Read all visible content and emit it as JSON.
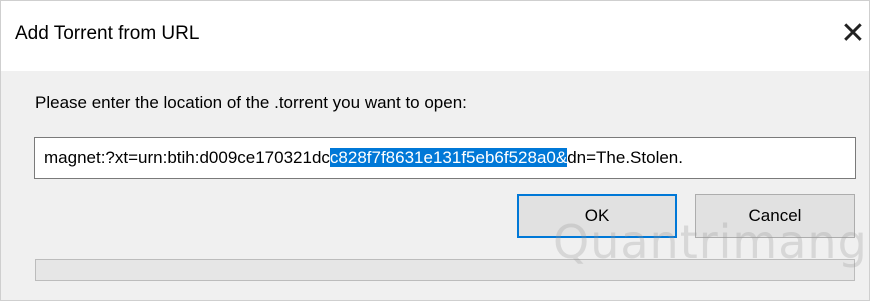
{
  "window": {
    "title": "Add Torrent from URL",
    "close_glyph": "✕"
  },
  "prompt": "Please enter the location of the .torrent you want to open:",
  "url_field": {
    "value_before_selection": "magnet:?xt=urn:btih:d009ce170321dc",
    "value_selected": "c828f7f8631e131f5eb6f528a0&",
    "value_after_selection": "dn=The.Stolen."
  },
  "buttons": {
    "ok_label": "OK",
    "cancel_label": "Cancel"
  },
  "progress": {
    "value": 0
  },
  "watermark": {
    "text": "Quantrimang"
  },
  "colors": {
    "selection": "#0078d7",
    "focus_border": "#0078d7",
    "dialog_bg": "#f0f0f0"
  }
}
